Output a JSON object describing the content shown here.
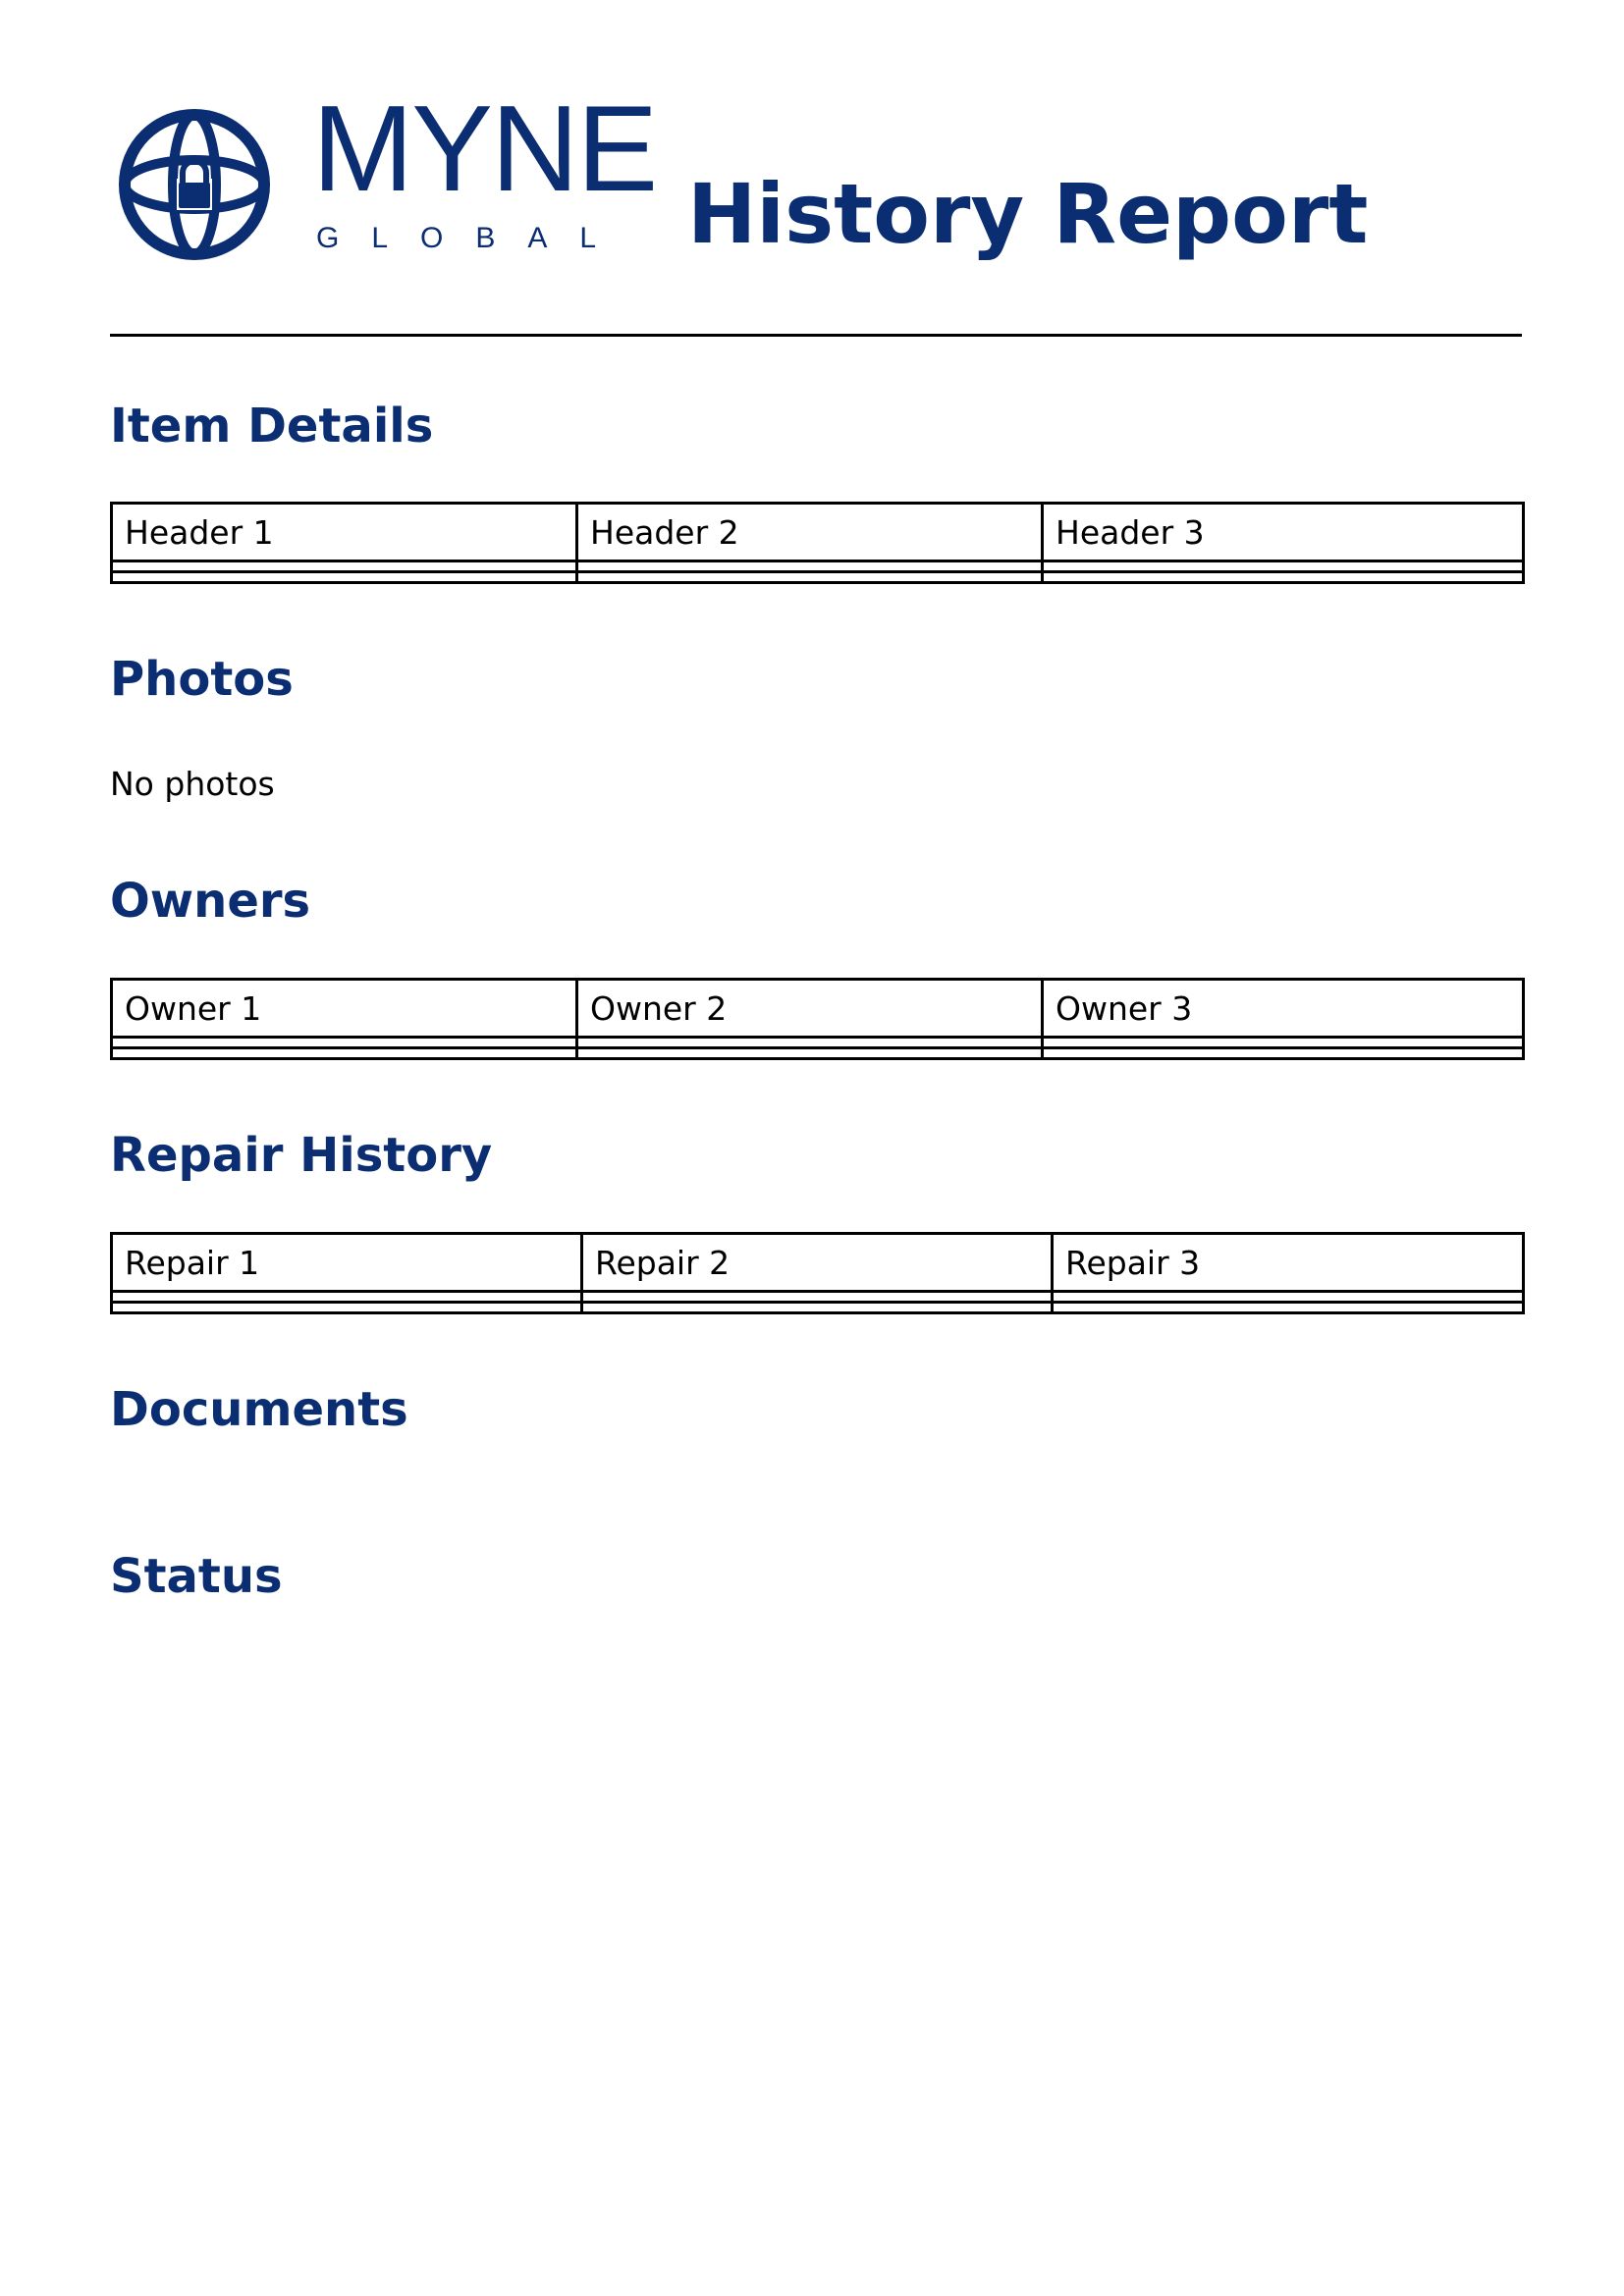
{
  "brand": {
    "name": "MYNE",
    "tagline": "GLOBAL",
    "color": "#0b2d72",
    "icon": "globe-lock-icon"
  },
  "report_title": "History Report",
  "sections": {
    "item_details": {
      "heading": "Item Details",
      "columns": [
        "Header 1",
        "Header 2",
        "Header 3"
      ]
    },
    "photos": {
      "heading": "Photos",
      "empty_text": "No photos"
    },
    "owners": {
      "heading": "Owners",
      "columns": [
        "Owner 1",
        "Owner 2",
        "Owner 3"
      ]
    },
    "repair_history": {
      "heading": "Repair History",
      "columns": [
        "Repair 1",
        "Repair 2",
        "Repair 3"
      ]
    },
    "documents": {
      "heading": "Documents"
    },
    "status": {
      "heading": "Status"
    }
  }
}
